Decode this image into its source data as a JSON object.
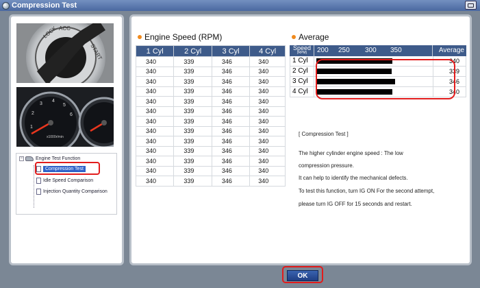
{
  "window": {
    "title": "Compression Test"
  },
  "engine_speed": {
    "title": "Engine Speed (RPM)",
    "columns": [
      "1 Cyl",
      "2 Cyl",
      "3 Cyl",
      "4 Cyl"
    ],
    "rows": [
      [
        "340",
        "339",
        "346",
        "340"
      ],
      [
        "340",
        "339",
        "346",
        "340"
      ],
      [
        "340",
        "339",
        "346",
        "340"
      ],
      [
        "340",
        "339",
        "346",
        "340"
      ],
      [
        "340",
        "339",
        "346",
        "340"
      ],
      [
        "340",
        "339",
        "346",
        "340"
      ],
      [
        "340",
        "339",
        "346",
        "340"
      ],
      [
        "340",
        "339",
        "346",
        "340"
      ],
      [
        "340",
        "339",
        "346",
        "340"
      ],
      [
        "340",
        "339",
        "346",
        "340"
      ],
      [
        "340",
        "339",
        "346",
        "340"
      ],
      [
        "340",
        "339",
        "346",
        "340"
      ],
      [
        "340",
        "339",
        "346",
        "340"
      ]
    ]
  },
  "average": {
    "title": "Average",
    "speed_label": "Speed",
    "speed_unit": "(RPM)",
    "ticks": [
      "200",
      "250",
      "300",
      "350"
    ],
    "average_label": "Average",
    "scale_min": 200,
    "scale_max": 350,
    "rows": [
      {
        "cyl": "1 Cyl",
        "value": "340"
      },
      {
        "cyl": "2 Cyl",
        "value": "339"
      },
      {
        "cyl": "3 Cyl",
        "value": "346"
      },
      {
        "cyl": "4 Cyl",
        "value": "340"
      }
    ]
  },
  "description": {
    "heading": "[ Compression Test ]",
    "lines": [
      "The higher cylinder engine speed : The low",
      "compression pressure.",
      "It can help to identify the mechanical defects.",
      "To test this function, turn IG ON For the second attempt,",
      "please turn IG OFF for 15 seconds and restart."
    ]
  },
  "tree": {
    "root": "Engine Test Function",
    "items": [
      "Compression Test",
      "Idle Speed Comparison",
      "Injection Quantity Comparison"
    ],
    "selected": 0
  },
  "buttons": {
    "ok": "OK"
  },
  "gauge_text": "x1000r/min",
  "colors": {
    "header": "#3e5b8a",
    "highlight": "#e21b1b",
    "bullet": "#f08a1d",
    "frame": "#7b8795"
  }
}
